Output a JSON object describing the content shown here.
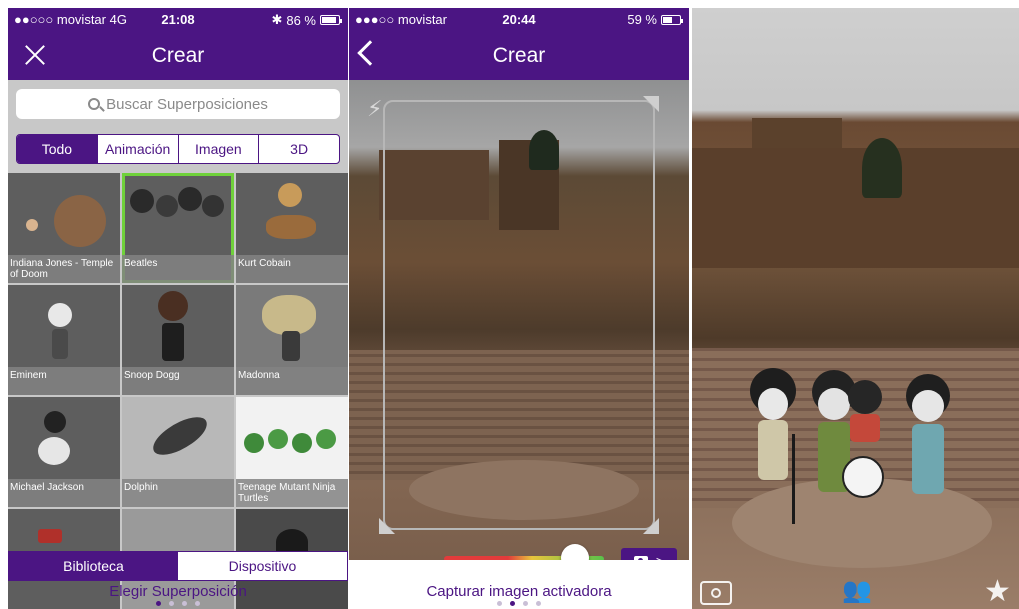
{
  "panel1": {
    "status": {
      "carrier": "●●○○○ movistar  4G",
      "time": "21:08",
      "battery": "86 %",
      "battery_level": 0.86
    },
    "header_title": "Crear",
    "search_placeholder": "Buscar Superposiciones",
    "filters": [
      "Todo",
      "Animación",
      "Imagen",
      "3D"
    ],
    "active_filter": "Todo",
    "tiles": [
      {
        "label": "Indiana Jones - Temple of Doom"
      },
      {
        "label": "Beatles"
      },
      {
        "label": "Kurt Cobain"
      },
      {
        "label": "Eminem"
      },
      {
        "label": "Snoop Dogg"
      },
      {
        "label": "Madonna"
      },
      {
        "label": "Michael Jackson"
      },
      {
        "label": "Dolphin"
      },
      {
        "label": "Teenage Mutant Ninja Turtles"
      }
    ],
    "selected_tile": "Beatles",
    "bottom_tabs": [
      "Biblioteca",
      "Dispositivo"
    ],
    "active_tab": "Dispositivo",
    "footer": "Elegir Superposición"
  },
  "panel2": {
    "status": {
      "carrier": "●●●○○ movistar",
      "time": "20:44",
      "battery": "59 %",
      "battery_level": 0.59
    },
    "header_title": "Crear",
    "slider_value": 0.82,
    "capture_label": ">",
    "footer": "Capturar imagen activadora"
  },
  "colors": {
    "brand": "#4b1583",
    "selection": "#6fd13a"
  }
}
